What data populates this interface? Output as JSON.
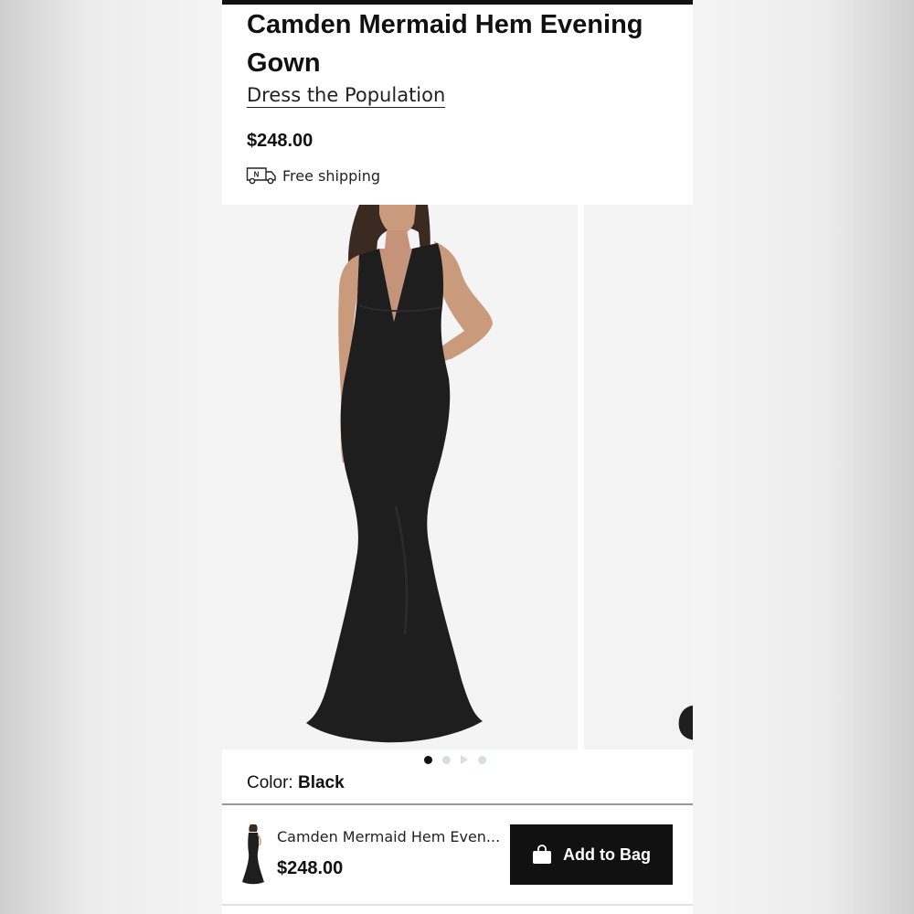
{
  "product": {
    "title": "Camden Mermaid Hem Evening Gown",
    "brand": "Dress the Population",
    "price": "$248.00",
    "shipping": "Free shipping",
    "shipping_icon_letter": "N"
  },
  "gallery": {
    "slide_count": 4,
    "active_index": 0
  },
  "color": {
    "label": "Color:",
    "value": "Black"
  },
  "sticky_bar": {
    "name": "Camden Mermaid Hem Even...",
    "price": "$248.00",
    "button_label": "Add to Bag",
    "button_icon": "shopping-bag-icon"
  },
  "colors": {
    "text": "#111111",
    "button_bg": "#111111",
    "dot_inactive": "#d6dde3"
  }
}
